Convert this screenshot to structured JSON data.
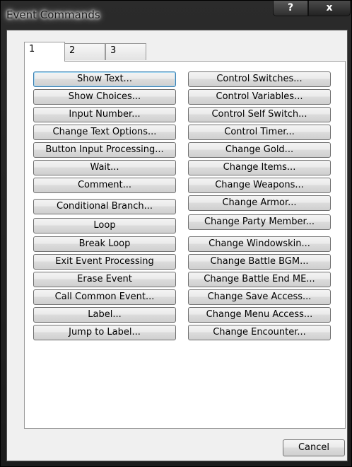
{
  "window": {
    "title": "Event Commands",
    "help_glyph": "?",
    "close_glyph": "x"
  },
  "tabs": [
    {
      "label": "1"
    },
    {
      "label": "2"
    },
    {
      "label": "3"
    }
  ],
  "left_buttons": [
    "Show Text...",
    "Show Choices...",
    "Input Number...",
    "Change Text Options...",
    "Button Input Processing...",
    "Wait...",
    "Comment...",
    "Conditional Branch...",
    "Loop",
    "Break Loop",
    "Exit Event Processing",
    "Erase Event",
    "Call Common Event...",
    "Label...",
    "Jump to Label..."
  ],
  "right_buttons": [
    "Control Switches...",
    "Control Variables...",
    "Control Self Switch...",
    "Control Timer...",
    "Change Gold...",
    "Change Items...",
    "Change Weapons...",
    "Change Armor...",
    "Change Party Member...",
    "Change Windowskin...",
    "Change Battle BGM...",
    "Change Battle End ME...",
    "Change Save Access...",
    "Change Menu Access...",
    "Change Encounter..."
  ],
  "footer": {
    "cancel_label": "Cancel"
  }
}
